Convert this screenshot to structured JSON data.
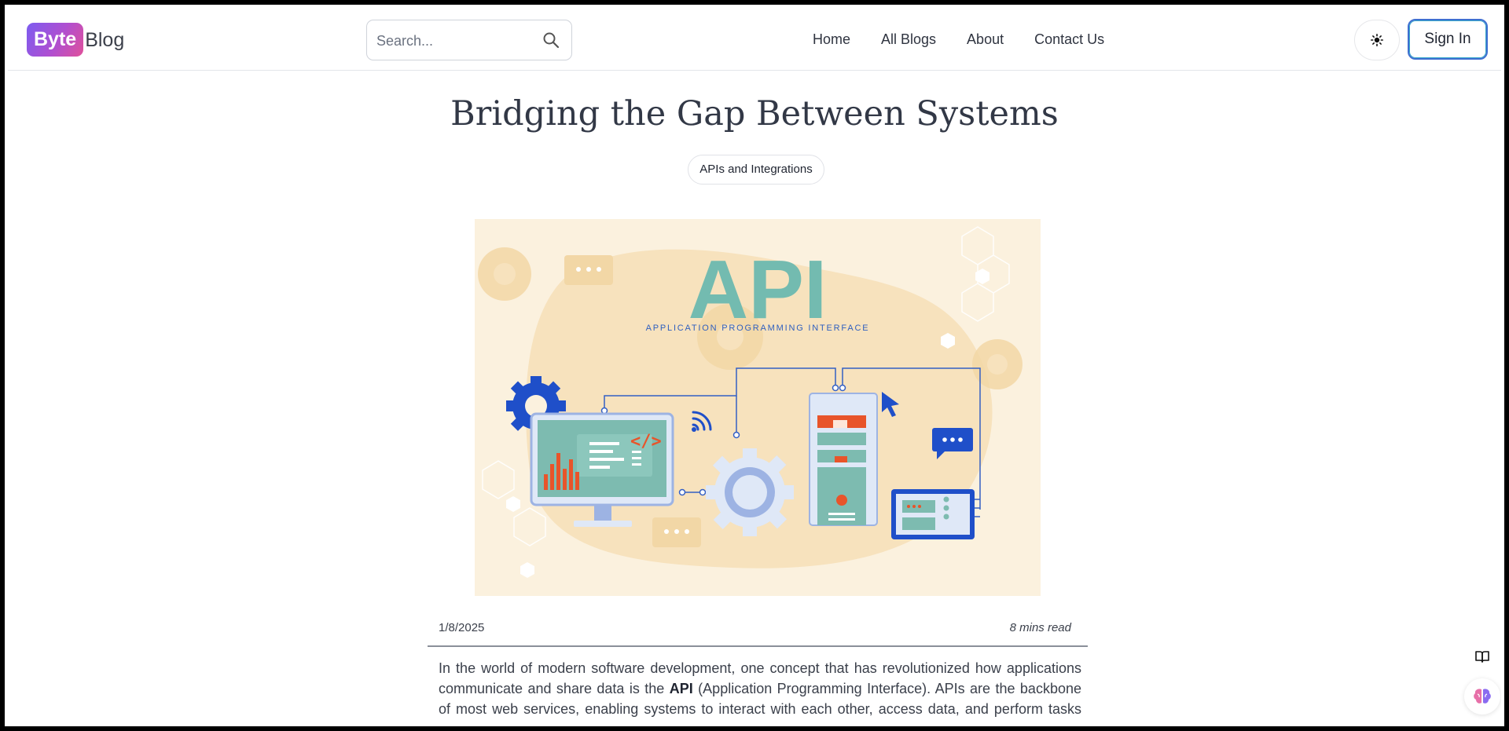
{
  "header": {
    "logo_badge": "Byte",
    "logo_rest": "Blog",
    "search_placeholder": "Search...",
    "nav": [
      "Home",
      "All Blogs",
      "About",
      "Contact Us"
    ],
    "theme_icon": "sun-icon",
    "signin_label": "Sign In"
  },
  "article": {
    "title": "Bridging the Gap Between Systems",
    "tag": "APIs and Integrations",
    "image": {
      "headline": "API",
      "subheadline": "APPLICATION PROGRAMMING INTERFACE"
    },
    "date": "1/8/2025",
    "read_time": "8 mins read",
    "intro_1": "In the world of modern software development, one concept that has revolutionized how applications communicate and share data is the ",
    "intro_bold": "API",
    "intro_2": " (Application Programming Interface). APIs are the backbone of most web services, enabling systems to interact with each other, access data, and perform tasks without"
  },
  "floating": {
    "book_icon": "book-open-icon",
    "brain_icon": "brain-icon"
  },
  "colors": {
    "accent_gradient": [
      "#7c5cf0",
      "#e0519a"
    ],
    "teal": "#6fb9ae",
    "blue": "#1f4fc9",
    "orange": "#e8542a",
    "hero_bg": "#fbf1de"
  }
}
